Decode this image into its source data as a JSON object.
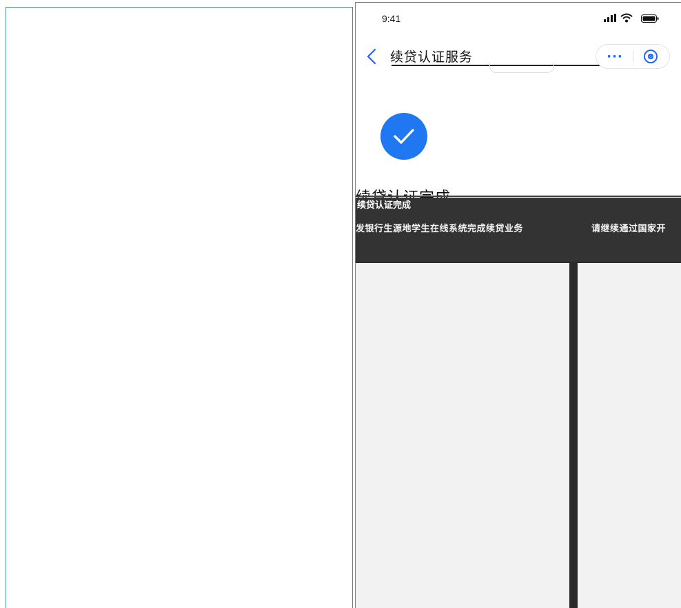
{
  "status_bar": {
    "time": "9:41",
    "icons": [
      "signal-icon",
      "wifi-icon",
      "battery-icon"
    ]
  },
  "nav": {
    "back_icon": "chevron-left-icon",
    "title": "续贷认证服务",
    "more_label": "···",
    "close_icon": "close-circle-icon"
  },
  "result": {
    "icon": "checkmark-icon",
    "title": "续贷认证完成"
  },
  "banner": {
    "title": "续贷认证完成",
    "left_text": "发银行生源地学生在线系统完成续贷业务",
    "right_text": "请继续通过国家开"
  },
  "colors": {
    "accent": "#1f77f2",
    "band": "#333333",
    "card": "#f2f2f2",
    "panel_border": "#4f86c6"
  }
}
